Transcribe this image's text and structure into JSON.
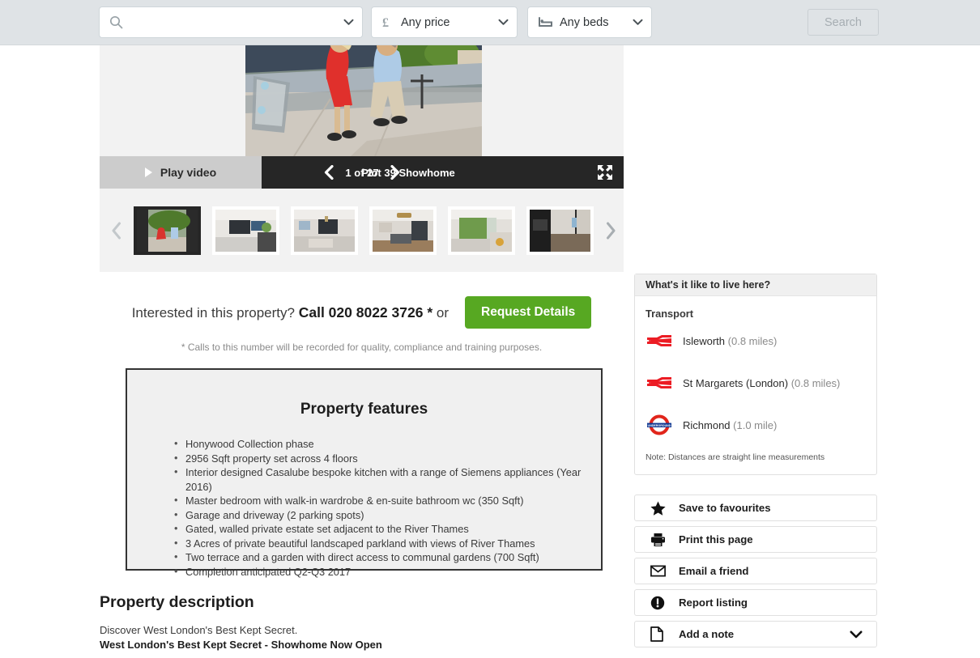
{
  "header": {
    "search": {
      "value": "",
      "placeholder": "",
      "icon": "search-icon",
      "chevron": "chevron-down-icon"
    },
    "price_filter": {
      "label": "Any price",
      "icon": "pound-icon"
    },
    "beds_filter": {
      "label": "Any beds",
      "icon": "bed-icon"
    },
    "search_button": {
      "label": "Search",
      "disabled": true
    }
  },
  "gallery": {
    "play_video_label": "Play video",
    "counter": "1 of 27",
    "caption": "Plot 39 Showhome",
    "prev_icon": "chevron-left-icon",
    "next_icon": "chevron-right-icon",
    "expand_icon": "expand-fullscreen-icon",
    "thumb_prev_icon": "chevron-left-icon",
    "thumb_next_icon": "chevron-right-icon",
    "thumbnails": [
      {
        "alt": "Exterior terrace with couple",
        "active": true
      },
      {
        "alt": "Living room with television"
      },
      {
        "alt": "Lounge with chandelier"
      },
      {
        "alt": "Dining area with pendant light"
      },
      {
        "alt": "Living room with garden view"
      },
      {
        "alt": "Dark gloss kitchen"
      }
    ]
  },
  "cta": {
    "lead_text": "Interested in this property?",
    "call_text": "Call 020 8022 3726 *",
    "or_text": "or",
    "request_button": "Request Details",
    "disclaimer": "* Calls to this number will be recorded for quality, compliance and training purposes."
  },
  "features": {
    "title": "Property features",
    "items": [
      "Honywood Collection phase",
      "2956 Sqft property set across 4 floors",
      "Interior designed Casalube bespoke kitchen with a range of Siemens appliances (Year 2016)",
      "Master bedroom with walk-in wardrobe & en-suite bathroom wc (350 Sqft)",
      "Garage and driveway (2 parking spots)",
      "Gated, walled private estate set adjacent to the River Thames",
      "3 Acres of private beautiful landscaped parkland with views of River Thames",
      "Two terrace and a garden with direct access to communal gardens (700 Sqft)",
      "Completion anticipated Q2-Q3 2017"
    ]
  },
  "description": {
    "title": "Property description",
    "line1": "Discover West London's Best Kept Secret.",
    "line2": "West London's Best Kept Secret - Showhome Now Open"
  },
  "sidebar": {
    "live_here_title": "What's it like to live here?",
    "transport_title": "Transport",
    "transport": [
      {
        "name": "Isleworth",
        "distance": "(0.8 miles)",
        "icon": "national-rail-icon"
      },
      {
        "name": "St Margarets (London)",
        "distance": "(0.8 miles)",
        "icon": "national-rail-icon"
      },
      {
        "name": "Richmond",
        "distance": "(1.0 mile)",
        "icon": "london-underground-icon"
      }
    ],
    "transport_note": "Note: Distances are straight line measurements",
    "actions": [
      {
        "label": "Save to favourites",
        "icon": "star-icon"
      },
      {
        "label": "Print this page",
        "icon": "printer-icon"
      },
      {
        "label": "Email a friend",
        "icon": "envelope-icon"
      },
      {
        "label": "Report listing",
        "icon": "exclamation-circle-icon"
      },
      {
        "label": "Add a note",
        "icon": "document-icon",
        "chevron": "chevron-down-icon"
      }
    ]
  },
  "colors": {
    "header_bg": "#dfe3e6",
    "accent_green": "#57a822",
    "gallery_bar": "#262626",
    "rail_red": "#ec1c24",
    "underground_blue": "#113892"
  }
}
